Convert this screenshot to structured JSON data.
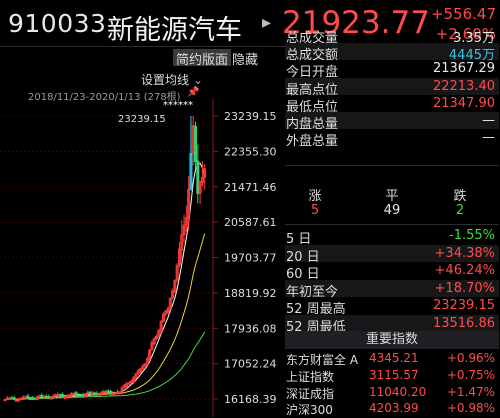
{
  "header": {
    "code": "910033",
    "name": "新能源汽车",
    "arrow": "▸",
    "price": "21923.77",
    "change": "+556.47",
    "change_pct": "+2.60%"
  },
  "chart_toolbar": {
    "tab1": "简约版面",
    "tab2": "隐藏",
    "setting": "设置均线",
    "range": "2018/11/23-2020/1/13 (278根)",
    "pin": "📌"
  },
  "chart_data": {
    "type": "candlestick",
    "y_ticks": [
      "23239.15",
      "22355.30",
      "21471.46",
      "20587.61",
      "19703.77",
      "18819.92",
      "17936.08",
      "17052.24",
      "16168.39"
    ],
    "annotation_high": "23239.15",
    "markers": "******",
    "ylim": [
      16168.39,
      23239.15
    ]
  },
  "stats": [
    {
      "label": "总成交量",
      "value": "3.35万",
      "color": "#e8e8e8"
    },
    {
      "label": "总成交额",
      "value": "4445万",
      "color": "#36c3e8"
    },
    {
      "label": "今日开盘",
      "value": "21367.29",
      "color": "#e8e8e8"
    },
    {
      "label": "最高点位",
      "value": "22213.40",
      "color": "#ff4b4b"
    },
    {
      "label": "最低点位",
      "value": "21347.90",
      "color": "#ff4b4b"
    },
    {
      "label": "内盘总量",
      "value": "—",
      "color": "#e8e8e8"
    },
    {
      "label": "外盘总量",
      "value": "—",
      "color": "#e8e8e8"
    }
  ],
  "breadth": {
    "up_label": "涨",
    "flat_label": "平",
    "down_label": "跌",
    "up": "5",
    "flat": "49",
    "down": "2"
  },
  "periods": [
    {
      "label": "5 日",
      "value": "-1.55%",
      "color": "#3ddc3d"
    },
    {
      "label": "20 日",
      "value": "+34.38%",
      "color": "#ff4b4b"
    },
    {
      "label": "60 日",
      "value": "+46.24%",
      "color": "#ff4b4b"
    },
    {
      "label": "年初至今",
      "value": "+18.70%",
      "color": "#ff4b4b"
    },
    {
      "label": "52 周最高",
      "value": "23239.15",
      "color": "#ff4b4b"
    },
    {
      "label": "52 周最低",
      "value": "13516.86",
      "color": "#ff4b4b"
    }
  ],
  "indices_title": "重要指数",
  "indices": [
    {
      "name": "东方财富全 A",
      "value": "4345.21",
      "pct": "+0.96%"
    },
    {
      "name": "上证指数",
      "value": "3115.57",
      "pct": "+0.75%"
    },
    {
      "name": "深证成指",
      "value": "11040.20",
      "pct": "+1.47%"
    },
    {
      "name": "沪深300",
      "value": "4203.99",
      "pct": "+0.98%"
    }
  ]
}
